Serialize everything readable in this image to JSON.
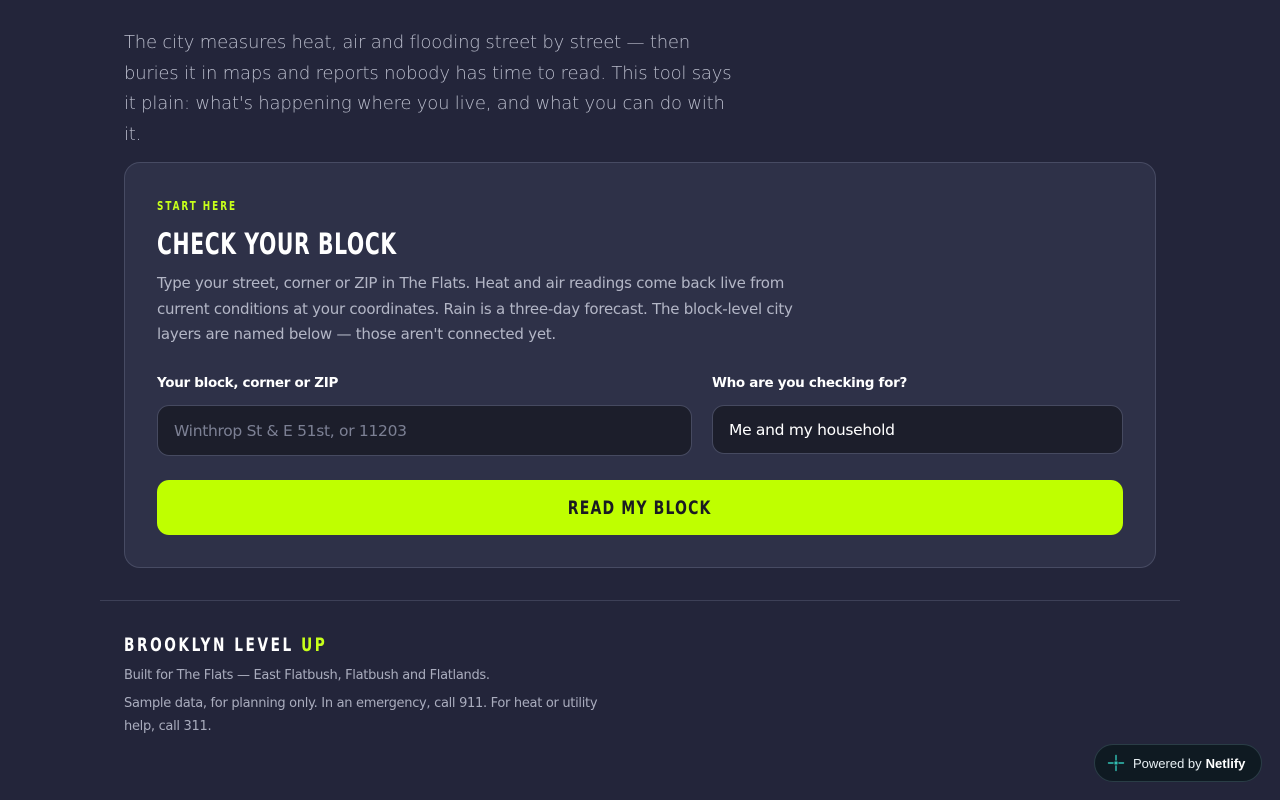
{
  "intro": "The city measures heat, air and flooding street by street — then buries it in maps and reports nobody has time to read. This tool says it plain: what's happening where you live, and what you can do with it.",
  "card": {
    "eyebrow": "START HERE",
    "title": "CHECK YOUR BLOCK",
    "description": "Type your street, corner or ZIP in The Flats. Heat and air readings come back live from current conditions at your coordinates. Rain is a three-day forecast. The block-level city layers are named below — those aren't connected yet.",
    "block_label": "Your block, corner or ZIP",
    "block_placeholder": "Winthrop St & E 51st, or 11203",
    "who_label": "Who are you checking for?",
    "who_value": "Me and my household",
    "cta_label": "READ MY BLOCK"
  },
  "footer": {
    "brand_main": "BROOKLYN LEVEL ",
    "brand_accent": "UP",
    "line1": "Built for The Flats — East Flatbush, Flatbush and Flatlands.",
    "line2": "Sample data, for planning only. In an emergency, call 911. For heat or utility help, call 311."
  },
  "badge": {
    "prefix": "Powered by",
    "name": "Netlify",
    "icon": "netlify-icon"
  },
  "colors": {
    "background": "#23253a",
    "card": "#2e3148",
    "accent": "#bfff00"
  }
}
